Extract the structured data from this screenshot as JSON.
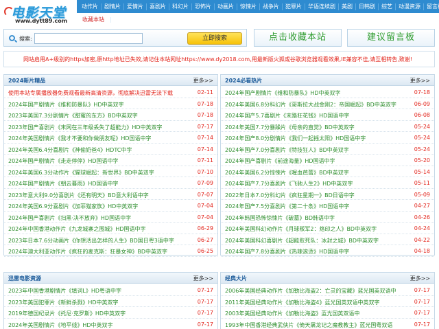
{
  "logo": {
    "main": "电影天堂",
    "sub": "www.dytt89.com"
  },
  "nav": [
    "动作片",
    "剧情片",
    "爱情片",
    "喜剧片",
    "科幻片",
    "恐怖片",
    "动画片",
    "惊悚片",
    "战争片",
    "犯罪片",
    "华语连续剧",
    "美剧",
    "日韩剧",
    "综艺",
    "动漫资源",
    "留言板"
  ],
  "subnav": {
    "item1": "收藏本站",
    "item2": "|"
  },
  "search": {
    "label": "搜索:",
    "placeholder": "",
    "button": "立即搜索"
  },
  "buttons": {
    "bookmark": "点击收藏本站",
    "feedback": "建议留言板"
  },
  "notice": "网站启用A+级别的https加密,原http地址已失效,请记住本站网址https://www.dy2018.com,用最新版火狐或谷歌浏览器观看效果,IE兼容不佳,请互相转告,致谢!",
  "panels": {
    "new": {
      "title": "2024新片精品",
      "more": "更多>>",
      "rows": [
        {
          "t": "使用本站专属播放器免费观看最新高清资源，彻底解决迅雷无法下载",
          "d": "02-11",
          "red": true
        },
        {
          "t": "2024年国产剧情片《维和防暴队》HD中英双字",
          "d": "07-18"
        },
        {
          "t": "2023年美国7.3分剧情片《甜蜜的东方》BD中英双字",
          "d": "07-18"
        },
        {
          "t": "2023年国产喜剧片《末网在三年级丢失了超能力》HD中英双字",
          "d": "07-17"
        },
        {
          "t": "2024年美国剧情片《我才不要和你做朋友呢》HD国语中字",
          "d": "07-14"
        },
        {
          "t": "2024年美国6.4分喜剧片《神偷奶爸4》HDTC中字",
          "d": "07-14"
        },
        {
          "t": "2024年国产剧情片《走走停停》HD国语中字",
          "d": "07-11"
        },
        {
          "t": "2024年美国6.3分动作片《猩球崛起：新世界》BD中英双字",
          "d": "07-10"
        },
        {
          "t": "2024年国产剧情片《朝云暮雨》HD国语中字",
          "d": "07-09"
        },
        {
          "t": "2023年意大利9.0分喜剧片《还有明天》BD意大利语中字",
          "d": "07-07"
        },
        {
          "t": "2024年美国6.9分喜剧片《加菲猫家族》HD中英双字",
          "d": "07-04"
        },
        {
          "t": "2024年国产喜剧片《扫黑·决不放弃》HD国语中字",
          "d": "07-04"
        },
        {
          "t": "2024年中国香港动作片《九龙城寨之围城》HD国语中字",
          "d": "06-29"
        },
        {
          "t": "2023年日本7.6分动画片《你想活出怎样的人生》BD国日粤3语中字",
          "d": "06-27"
        },
        {
          "t": "2024年澳大利亚动作片《疯狂的麦克斯：狂暴女神》BD中英双字",
          "d": "06-25"
        }
      ]
    },
    "hot": {
      "title": "2024必看热片",
      "more": "更多>>",
      "rows": [
        {
          "t": "2024年国产剧情片《维和防暴队》HD中英双字",
          "d": "07-18"
        },
        {
          "t": "2024年美国6.8分科幻片《哥斯拉大战金刚2：帝国崛起》BD中英双字",
          "d": "06-09"
        },
        {
          "t": "2024年国产5.7喜剧片《末路狂花钱》HD国语中字",
          "d": "06-08"
        },
        {
          "t": "2024年美国7.7分暴躁片《母亲的直觉》BD中英双字",
          "d": "05-24"
        },
        {
          "t": "2024年国产8.0分剧情片《我们一起摇太阳》HD国语中字",
          "d": "05-24"
        },
        {
          "t": "2024年国产7.0分喜剧片《特技狂人》BD中英双字",
          "d": "05-24"
        },
        {
          "t": "2024年国产喜剧片《前途海量》HD国语中字",
          "d": "05-20"
        },
        {
          "t": "2024年美国6.2分惊悚片《喔血芭蕾》BD中英双字",
          "d": "05-14"
        },
        {
          "t": "2024年国产7.7分喜剧片《飞驰人生2》HD中英双字",
          "d": "05-11"
        },
        {
          "t": "2022年日本7.0分科幻片《疯狂星期一》BD日语中字",
          "d": "05-09"
        },
        {
          "t": "2024年国产7.5分喜剧片《第二十条》HD国语中字",
          "d": "04-27"
        },
        {
          "t": "2024年韩国恐怖惊悚片《破墓》BD韩语中字",
          "d": "04-26"
        },
        {
          "t": "2024年美国科幻动作片《月球叛军2：烙印之人》BD中英双字",
          "d": "04-24"
        },
        {
          "t": "2024年美国科幻喜剧片《超能败死队：冰封之城》BD中英双字",
          "d": "04-22"
        },
        {
          "t": "2024年国产7.8分喜剧片《热辣滚烫》HD国语中字",
          "d": "04-18"
        }
      ]
    },
    "thunder": {
      "title": "迅雷电影资源",
      "more": "更多>>",
      "rows": [
        {
          "t": "2023年中国香港剧情片《填词L》HD粤语中字",
          "d": "07-17"
        },
        {
          "t": "2023年美国犯罪片《新鲜杀戮》HD中英双字",
          "d": "07-17"
        },
        {
          "t": "2019年德国纪录片《托尼·克罗斯》HD中英双字",
          "d": "07-17"
        },
        {
          "t": "2024年美国剧情片《地平线》HD中英双字",
          "d": "07-17"
        }
      ]
    },
    "classic": {
      "title": "经典大片",
      "more": "更多>>",
      "rows": [
        {
          "t": "2006年美国经典动作片《加勒比海盗2：亡灵的宝藏》蓝光国英双语中",
          "d": "07-17"
        },
        {
          "t": "2011年美国经典动作片《加勒比海盗4》蓝光国英双语中英双字",
          "d": "07-17"
        },
        {
          "t": "2003年美国经典动作片《加勒比海盗》蓝光国英双语中",
          "d": "07-17"
        },
        {
          "t": "1993年中国香港经典武侠片《倚天屠龙记之魔教教主》蓝光国粤双语",
          "d": "07-17"
        }
      ]
    }
  }
}
